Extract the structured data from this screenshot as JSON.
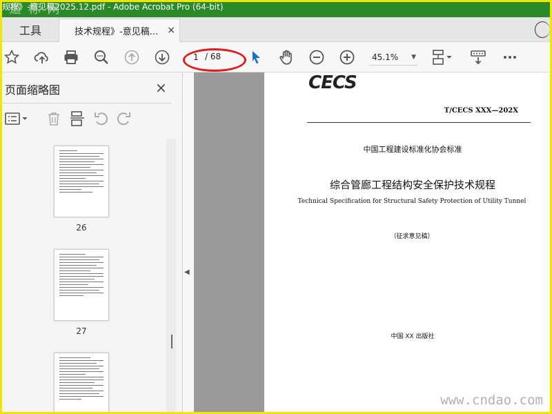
{
  "window": {
    "title": "规程》-意见稿2025.12.pdf - Adobe Acrobat Pro (64-bit)",
    "watermark_top": "道 标 网",
    "watermark_bottom": "www.cndao.com"
  },
  "tabs": {
    "tools_label": "工具",
    "doc_tab_label": "技术规程》-意见稿...",
    "doc_tab_close": "×"
  },
  "toolbar": {
    "icons": [
      "star-icon",
      "cloud-upload-icon",
      "print-icon",
      "zoom-search-icon",
      "page-up-icon",
      "page-down-icon",
      "select-arrow-icon",
      "hand-icon",
      "zoom-out-icon",
      "zoom-in-icon",
      "page-fit-icon",
      "more-tools-icon",
      "more-icon"
    ],
    "current_page": "1",
    "total_pages": "/ 68",
    "zoom_value": "45.1%",
    "accent_color": "#1a6fc7",
    "highlight_color": "#e01b1b"
  },
  "left_panel": {
    "title": "页面缩略图",
    "close_label": "×",
    "thumbnails": [
      {
        "label": "26"
      },
      {
        "label": "27"
      },
      {
        "label": ""
      }
    ]
  },
  "document": {
    "logo": "CECS",
    "standard_number": "T/CECS XXX—202X",
    "association": "中国工程建设标准化协会标准",
    "title_cn": "综合管廊工程结构安全保护技术规程",
    "title_en": "Technical Specification for Structural Safety Protection of Utility Tunnel",
    "draft_note": "（征求意见稿）",
    "publisher": "中国 XX 出版社"
  }
}
